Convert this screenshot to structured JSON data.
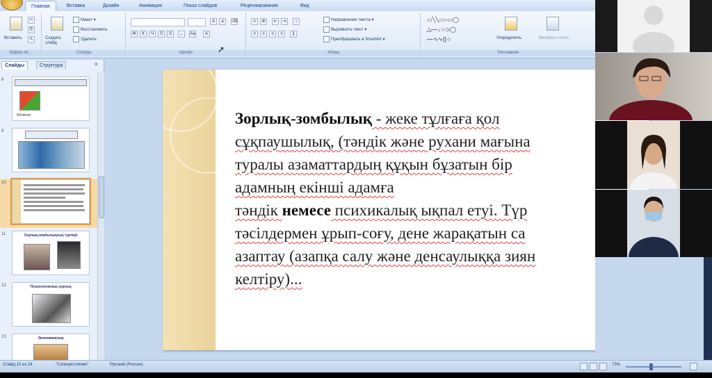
{
  "ribbon": {
    "tabs": [
      "Главная",
      "Вставка",
      "Дизайн",
      "Анимация",
      "Показ слайдов",
      "Рецензирование",
      "Вид"
    ],
    "active_tab": "Главная",
    "groups": {
      "clipboard": {
        "label": "Буфер об...",
        "paste": "Вставить"
      },
      "slides": {
        "label": "Слайды",
        "new_slide": "Создать слайд",
        "layout": "Макет",
        "reset": "Восстановить",
        "delete": "Удалить"
      },
      "font": {
        "label": "Шрифт"
      },
      "paragraph": {
        "label": "Абзац",
        "text_direction": "Направление текста",
        "align_text": "Выровнять текст",
        "smartart": "Преобразовать в SmartArt"
      },
      "drawing": {
        "label": "Рисование",
        "arrange": "Упорядочить",
        "quick_styles": "Экспресс-стили"
      }
    }
  },
  "left_panel": {
    "tabs": [
      "Слайды",
      "Структура"
    ],
    "active_tab": "Слайды",
    "close_glyph": "×",
    "slides": [
      {
        "number": "8",
        "title": "",
        "image_label": "Windows"
      },
      {
        "number": "9",
        "title": "",
        "image_label": ""
      },
      {
        "number": "10",
        "title": "",
        "image_label": "",
        "selected": true
      },
      {
        "number": "11",
        "title": "Зорлық-зомбылықтың түрлері",
        "image_label": ""
      },
      {
        "number": "12",
        "title": "Психологиялық зорлық",
        "image_label": ""
      },
      {
        "number": "13",
        "title": "Экономикалық",
        "image_label": ""
      }
    ]
  },
  "slide": {
    "lines": [
      [
        {
          "t": "Зорлық-зомбылық",
          "b": true
        },
        {
          "t": " - жеке тұлғаға қол",
          "w": true
        }
      ],
      [
        {
          "t": "сұқпаушылық, (тәндік және рухани мағына",
          "w": true
        }
      ],
      [
        {
          "t": "туралы азаматтардың құқын бұзатын бір",
          "w": true
        }
      ],
      [
        {
          "t": "адамның екінші адамға",
          "w": true
        }
      ],
      [
        {
          "t": "тәндік ",
          "w": true
        },
        {
          "t": "немесе",
          "b": true
        },
        {
          "t": " психикалық ықпал етуі. Түр",
          "w": true
        }
      ],
      [
        {
          "t": "тәсілдермен ұрып-соғу, дене жарақатын са",
          "w": true
        }
      ],
      [
        {
          "t": "азаптау (азапқа салу және денсаулыққа зиян",
          "w": true
        }
      ],
      [
        {
          "t": "келтіру)...",
          "w": true
        }
      ]
    ]
  },
  "status_bar": {
    "slide_counter": "Слайд 10 из 24",
    "theme": "\"Солнцестояние\"",
    "language": "Русский (Россия)",
    "zoom": "73%"
  },
  "video": {
    "participants": 4
  }
}
